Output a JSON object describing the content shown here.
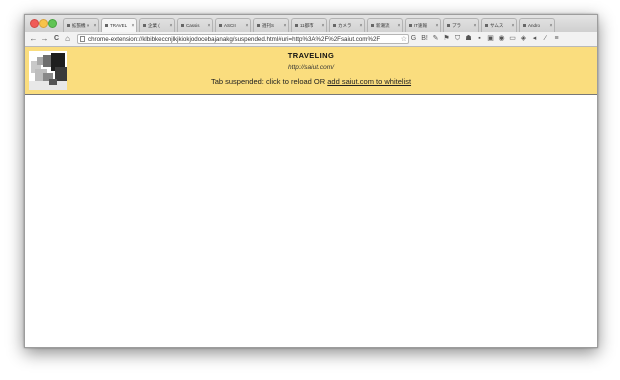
{
  "browser": {
    "tabs": [
      {
        "label": "拡張機 ×",
        "active": false
      },
      {
        "label": "TRAVEL",
        "active": true
      },
      {
        "label": "企業 (",
        "active": false
      },
      {
        "label": "Cassis",
        "active": false
      },
      {
        "label": "ASCII",
        "active": false
      },
      {
        "label": "週刊S",
        "active": false
      },
      {
        "label": "11都市",
        "active": false
      },
      {
        "label": "カメラ",
        "active": false
      },
      {
        "label": "新潮流",
        "active": false
      },
      {
        "label": "IT速報",
        "active": false
      },
      {
        "label": "プラ",
        "active": false
      },
      {
        "label": "サムス",
        "active": false
      },
      {
        "label": "Andro",
        "active": false
      }
    ],
    "tab_close_glyph": "×",
    "toolbar": {
      "back_glyph": "←",
      "forward_glyph": "→",
      "reload_glyph": "C",
      "home_glyph": "⌂",
      "url": "chrome-extension://klbibkeccnjlkjkiokjodocebajanakg/suspended.html#uri=http%3A%2F%2Fsaiut.com%2F",
      "star_glyph": "☆",
      "extension_icons": [
        "G",
        "B!",
        "✎",
        "⚑",
        "⛉",
        "☗",
        "▪",
        "▣",
        "◉",
        "▭",
        "◈",
        "◂",
        "∕",
        "≡"
      ]
    }
  },
  "suspended": {
    "title": "TRAVELING",
    "url": "http://saiut.com/",
    "message_prefix": "Tab suspended: click to reload OR ",
    "whitelist_link": "add saiut.com to whitelist"
  },
  "colors": {
    "banner_bg": "#fadd7e",
    "content_bg": "#ffffff"
  }
}
